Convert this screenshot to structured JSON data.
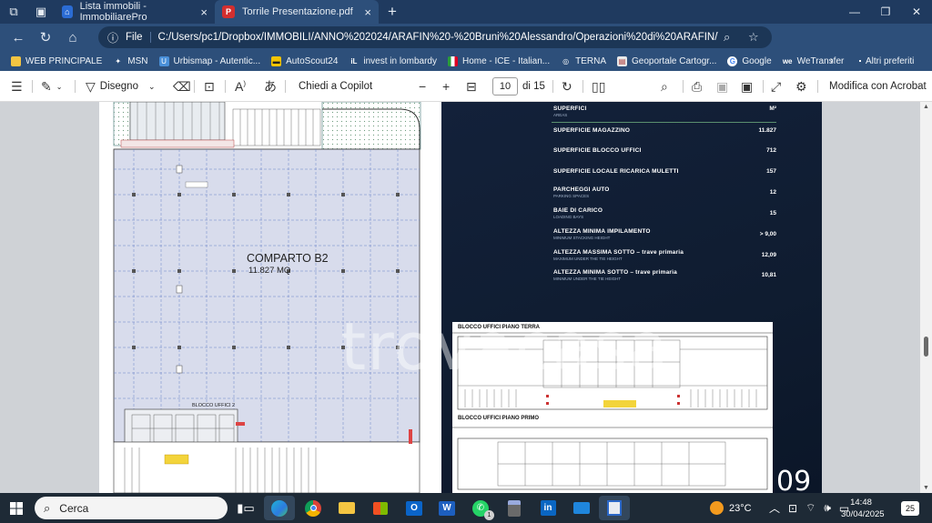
{
  "titlebar": {
    "tabs": [
      {
        "title": "Lista immobili - ImmobiliarePro",
        "icon": "home-icon"
      },
      {
        "title": "Torrile Presentazione.pdf",
        "icon": "pdf-icon"
      }
    ]
  },
  "address": {
    "scheme_label": "File",
    "url": "C:/Users/pc1/Dropbox/IMMOBILI/ANNO%202024/ARAFIN%20-%20Bruni%20Alessandro/Operazioni%20di%20ARAFIN/Torrile/Tor..."
  },
  "bookmarks": [
    {
      "label": "WEB PRINCIPALE",
      "icon": "folder-icon"
    },
    {
      "label": "MSN",
      "icon": "msn-icon"
    },
    {
      "label": "Urbismap - Autentic...",
      "icon": "urbismap-icon"
    },
    {
      "label": "AutoScout24",
      "icon": "autoscout-icon"
    },
    {
      "label": "invest in lombardy",
      "icon": "invest-icon"
    },
    {
      "label": "Home - ICE - Italian...",
      "icon": "ice-icon"
    },
    {
      "label": "TERNA",
      "icon": "globe-icon"
    },
    {
      "label": "Geoportale Cartogr...",
      "icon": "geoportale-icon"
    },
    {
      "label": "Google",
      "icon": "google-icon"
    },
    {
      "label": "WeTransfer",
      "icon": "wetransfer-icon"
    }
  ],
  "bookmarks_other": "Altri preferiti",
  "pdf_toolbar": {
    "draw_label": "Disegno",
    "copilot_label": "Chiedi a Copilot",
    "page_current": "10",
    "page_total": "di 15",
    "edit_label": "Modifica con Acrobat"
  },
  "document": {
    "comparto_title": "COMPARTO B2",
    "comparto_area": "11.827 MQ",
    "blocco_label": "BLOCCO UFFICI 2",
    "watermark": "trovacasa",
    "spec_header": {
      "label": "SUPERFICI",
      "sub": "AREAS",
      "unit": "M²"
    },
    "specs": [
      {
        "label": "SUPERFICIE MAGAZZINO",
        "sub": "",
        "value": "11.827"
      },
      {
        "label": "SUPERFICIE BLOCCO UFFICI",
        "sub": "",
        "value": "712"
      },
      {
        "label": "SUPERFICIE LOCALE RICARICA MULETTI",
        "sub": "",
        "value": "157"
      },
      {
        "label": "PARCHEGGI AUTO",
        "sub": "PARKING SPACES",
        "value": "12"
      },
      {
        "label": "BAIE DI CARICO",
        "sub": "LOADING BAYS",
        "value": "15"
      },
      {
        "label": "ALTEZZA MINIMA IMPILAMENTO",
        "sub": "MINIMUM STACKING HEIGHT",
        "value": "> 9,00"
      },
      {
        "label": "ALTEZZA MASSIMA SOTTO – trave primaria",
        "sub": "MAXIMUM UNDER THE TIE HEIGHT",
        "value": "12,09"
      },
      {
        "label": "ALTEZZA MINIMA SOTTO – trave primaria",
        "sub": "MINIMUM UNDER THE TIE HEIGHT",
        "value": "10,81"
      }
    ],
    "plan_ground": "BLOCCO UFFICI  PIANO TERRA",
    "plan_first": "BLOCCO UFFICI  PIANO PRIMO",
    "page_number": "09"
  },
  "taskbar": {
    "search_label": "Cerca",
    "weather": "23°C",
    "time": "14:48",
    "date": "30/04/2025",
    "notifications": "25",
    "whatsapp_badge": "1"
  }
}
